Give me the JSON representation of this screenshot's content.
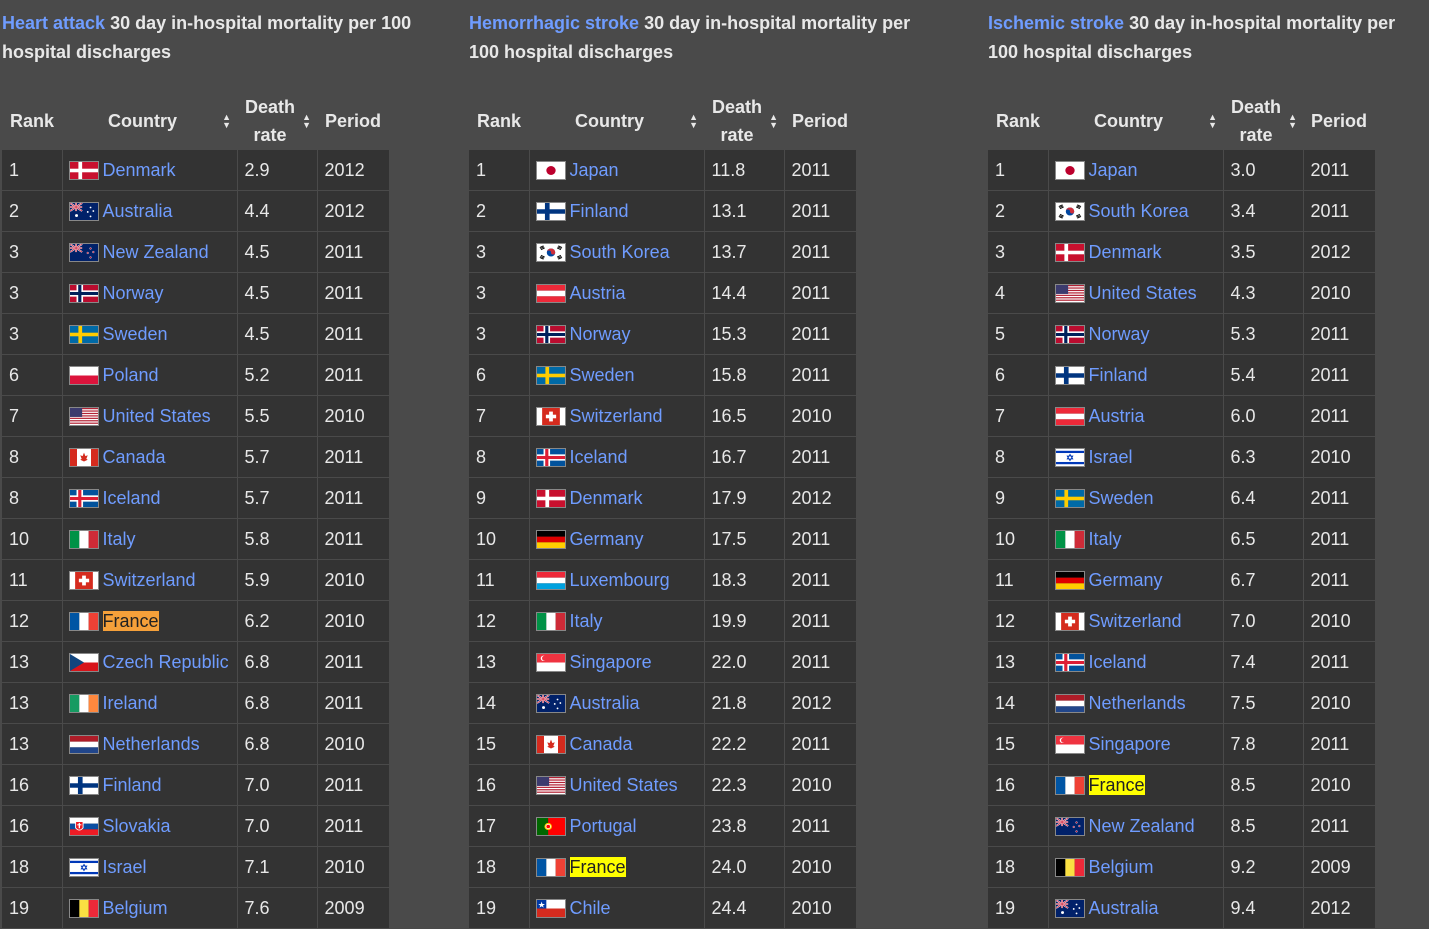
{
  "panels": [
    {
      "caption_link": "Heart attack",
      "caption_rest": " 30 day in-hospital mortality per 100 hospital discharges",
      "headers": {
        "rank": "Rank",
        "country": "Country",
        "death_line1": "Death",
        "death_line2": "rate",
        "period": "Period"
      },
      "rows": [
        {
          "rank": "1",
          "flag": "denmark",
          "country": "Denmark",
          "rate": "2.9",
          "period": "2012",
          "mark": ""
        },
        {
          "rank": "2",
          "flag": "australia",
          "country": "Australia",
          "rate": "4.4",
          "period": "2012",
          "mark": ""
        },
        {
          "rank": "3",
          "flag": "new-zealand",
          "country": "New Zealand",
          "rate": "4.5",
          "period": "2011",
          "mark": ""
        },
        {
          "rank": "3",
          "flag": "norway",
          "country": "Norway",
          "rate": "4.5",
          "period": "2011",
          "mark": ""
        },
        {
          "rank": "3",
          "flag": "sweden",
          "country": "Sweden",
          "rate": "4.5",
          "period": "2011",
          "mark": ""
        },
        {
          "rank": "6",
          "flag": "poland",
          "country": "Poland",
          "rate": "5.2",
          "period": "2011",
          "mark": ""
        },
        {
          "rank": "7",
          "flag": "united-states",
          "country": "United States",
          "rate": "5.5",
          "period": "2010",
          "mark": ""
        },
        {
          "rank": "8",
          "flag": "canada",
          "country": "Canada",
          "rate": "5.7",
          "period": "2011",
          "mark": ""
        },
        {
          "rank": "8",
          "flag": "iceland",
          "country": "Iceland",
          "rate": "5.7",
          "period": "2011",
          "mark": ""
        },
        {
          "rank": "10",
          "flag": "italy",
          "country": "Italy",
          "rate": "5.8",
          "period": "2011",
          "mark": ""
        },
        {
          "rank": "11",
          "flag": "switzerland",
          "country": "Switzerland",
          "rate": "5.9",
          "period": "2010",
          "mark": ""
        },
        {
          "rank": "12",
          "flag": "france",
          "country": "France",
          "rate": "6.2",
          "period": "2010",
          "mark": "orange"
        },
        {
          "rank": "13",
          "flag": "czech-republic",
          "country": "Czech Republic",
          "rate": "6.8",
          "period": "2011",
          "mark": ""
        },
        {
          "rank": "13",
          "flag": "ireland",
          "country": "Ireland",
          "rate": "6.8",
          "period": "2011",
          "mark": ""
        },
        {
          "rank": "13",
          "flag": "netherlands",
          "country": "Netherlands",
          "rate": "6.8",
          "period": "2010",
          "mark": ""
        },
        {
          "rank": "16",
          "flag": "finland",
          "country": "Finland",
          "rate": "7.0",
          "period": "2011",
          "mark": ""
        },
        {
          "rank": "16",
          "flag": "slovakia",
          "country": "Slovakia",
          "rate": "7.0",
          "period": "2011",
          "mark": ""
        },
        {
          "rank": "18",
          "flag": "israel",
          "country": "Israel",
          "rate": "7.1",
          "period": "2010",
          "mark": ""
        },
        {
          "rank": "19",
          "flag": "belgium",
          "country": "Belgium",
          "rate": "7.6",
          "period": "2009",
          "mark": ""
        }
      ]
    },
    {
      "caption_link": "Hemorrhagic stroke",
      "caption_rest": " 30 day in-hospital mortality per 100 hospital discharges",
      "headers": {
        "rank": "Rank",
        "country": "Country",
        "death_line1": "Death",
        "death_line2": "rate",
        "period": "Period"
      },
      "rows": [
        {
          "rank": "1",
          "flag": "japan",
          "country": "Japan",
          "rate": "11.8",
          "period": "2011",
          "mark": ""
        },
        {
          "rank": "2",
          "flag": "finland",
          "country": "Finland",
          "rate": "13.1",
          "period": "2011",
          "mark": ""
        },
        {
          "rank": "3",
          "flag": "south-korea",
          "country": "South Korea",
          "rate": "13.7",
          "period": "2011",
          "mark": ""
        },
        {
          "rank": "3",
          "flag": "austria",
          "country": "Austria",
          "rate": "14.4",
          "period": "2011",
          "mark": ""
        },
        {
          "rank": "3",
          "flag": "norway",
          "country": "Norway",
          "rate": "15.3",
          "period": "2011",
          "mark": ""
        },
        {
          "rank": "6",
          "flag": "sweden",
          "country": "Sweden",
          "rate": "15.8",
          "period": "2011",
          "mark": ""
        },
        {
          "rank": "7",
          "flag": "switzerland",
          "country": "Switzerland",
          "rate": "16.5",
          "period": "2010",
          "mark": ""
        },
        {
          "rank": "8",
          "flag": "iceland",
          "country": "Iceland",
          "rate": "16.7",
          "period": "2011",
          "mark": ""
        },
        {
          "rank": "9",
          "flag": "denmark",
          "country": "Denmark",
          "rate": "17.9",
          "period": "2012",
          "mark": ""
        },
        {
          "rank": "10",
          "flag": "germany",
          "country": "Germany",
          "rate": "17.5",
          "period": "2011",
          "mark": ""
        },
        {
          "rank": "11",
          "flag": "luxembourg",
          "country": "Luxembourg",
          "rate": "18.3",
          "period": "2011",
          "mark": ""
        },
        {
          "rank": "12",
          "flag": "italy",
          "country": "Italy",
          "rate": "19.9",
          "period": "2011",
          "mark": ""
        },
        {
          "rank": "13",
          "flag": "singapore",
          "country": "Singapore",
          "rate": "22.0",
          "period": "2011",
          "mark": ""
        },
        {
          "rank": "14",
          "flag": "australia",
          "country": "Australia",
          "rate": "21.8",
          "period": "2012",
          "mark": ""
        },
        {
          "rank": "15",
          "flag": "canada",
          "country": "Canada",
          "rate": "22.2",
          "period": "2011",
          "mark": ""
        },
        {
          "rank": "16",
          "flag": "united-states",
          "country": "United States",
          "rate": "22.3",
          "period": "2010",
          "mark": ""
        },
        {
          "rank": "17",
          "flag": "portugal",
          "country": "Portugal",
          "rate": "23.8",
          "period": "2011",
          "mark": ""
        },
        {
          "rank": "18",
          "flag": "france",
          "country": "France",
          "rate": "24.0",
          "period": "2010",
          "mark": "yellow"
        },
        {
          "rank": "19",
          "flag": "chile",
          "country": "Chile",
          "rate": "24.4",
          "period": "2010",
          "mark": ""
        }
      ]
    },
    {
      "caption_link": "Ischemic stroke",
      "caption_rest": " 30 day in-hospital mortality per 100 hospital discharges",
      "headers": {
        "rank": "Rank",
        "country": "Country",
        "death_line1": "Death",
        "death_line2": "rate",
        "period": "Period"
      },
      "rows": [
        {
          "rank": "1",
          "flag": "japan",
          "country": "Japan",
          "rate": "3.0",
          "period": "2011",
          "mark": ""
        },
        {
          "rank": "2",
          "flag": "south-korea",
          "country": "South Korea",
          "rate": "3.4",
          "period": "2011",
          "mark": ""
        },
        {
          "rank": "3",
          "flag": "denmark",
          "country": "Denmark",
          "rate": "3.5",
          "period": "2012",
          "mark": ""
        },
        {
          "rank": "4",
          "flag": "united-states",
          "country": "United States",
          "rate": "4.3",
          "period": "2010",
          "mark": ""
        },
        {
          "rank": "5",
          "flag": "norway",
          "country": "Norway",
          "rate": "5.3",
          "period": "2011",
          "mark": ""
        },
        {
          "rank": "6",
          "flag": "finland",
          "country": "Finland",
          "rate": "5.4",
          "period": "2011",
          "mark": ""
        },
        {
          "rank": "7",
          "flag": "austria",
          "country": "Austria",
          "rate": "6.0",
          "period": "2011",
          "mark": ""
        },
        {
          "rank": "8",
          "flag": "israel",
          "country": "Israel",
          "rate": "6.3",
          "period": "2010",
          "mark": ""
        },
        {
          "rank": "9",
          "flag": "sweden",
          "country": "Sweden",
          "rate": "6.4",
          "period": "2011",
          "mark": ""
        },
        {
          "rank": "10",
          "flag": "italy",
          "country": "Italy",
          "rate": "6.5",
          "period": "2011",
          "mark": ""
        },
        {
          "rank": "11",
          "flag": "germany",
          "country": "Germany",
          "rate": "6.7",
          "period": "2011",
          "mark": ""
        },
        {
          "rank": "12",
          "flag": "switzerland",
          "country": "Switzerland",
          "rate": "7.0",
          "period": "2010",
          "mark": ""
        },
        {
          "rank": "13",
          "flag": "iceland",
          "country": "Iceland",
          "rate": "7.4",
          "period": "2011",
          "mark": ""
        },
        {
          "rank": "14",
          "flag": "netherlands",
          "country": "Netherlands",
          "rate": "7.5",
          "period": "2010",
          "mark": ""
        },
        {
          "rank": "15",
          "flag": "singapore",
          "country": "Singapore",
          "rate": "7.8",
          "period": "2011",
          "mark": ""
        },
        {
          "rank": "16",
          "flag": "france",
          "country": "France",
          "rate": "8.5",
          "period": "2010",
          "mark": "yellow"
        },
        {
          "rank": "16",
          "flag": "new-zealand",
          "country": "New Zealand",
          "rate": "8.5",
          "period": "2011",
          "mark": ""
        },
        {
          "rank": "18",
          "flag": "belgium",
          "country": "Belgium",
          "rate": "9.2",
          "period": "2009",
          "mark": ""
        },
        {
          "rank": "19",
          "flag": "australia",
          "country": "Australia",
          "rate": "9.4",
          "period": "2012",
          "mark": ""
        }
      ]
    }
  ],
  "colors": {
    "link": "#6f9cff",
    "background": "#4a4a4a",
    "cell": "#333333",
    "highlight_orange": "#f5a03a",
    "highlight_yellow": "#ffff00"
  }
}
